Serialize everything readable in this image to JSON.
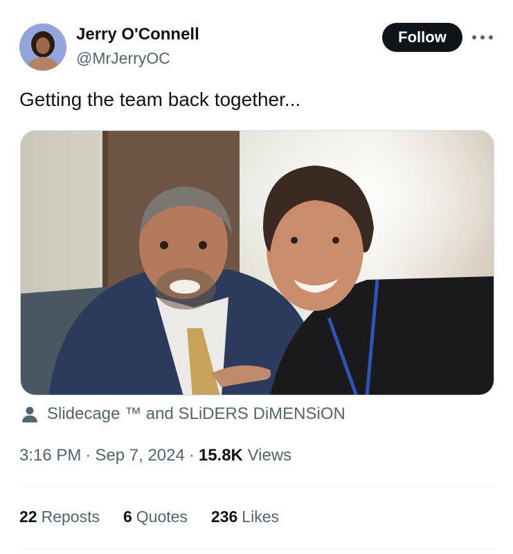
{
  "author": {
    "display_name": "Jerry O'Connell",
    "handle": "@MrJerryOC",
    "avatar_icon": "profile-photo"
  },
  "header": {
    "follow_label": "Follow",
    "more_icon": "more-dots-icon"
  },
  "tweet": {
    "text": "Getting the team back together..."
  },
  "media": {
    "kind": "photo"
  },
  "tags": {
    "icon": "person-icon",
    "text": "Slidecage ™ and SLiDERS DiMENSiON"
  },
  "meta": {
    "time": "3:16 PM",
    "separator": "·",
    "date": "Sep 7, 2024",
    "views_count": "15.8K",
    "views_label": "Views"
  },
  "stats": {
    "reposts_count": "22",
    "reposts_label": "Reposts",
    "quotes_count": "6",
    "quotes_label": "Quotes",
    "likes_count": "236",
    "likes_label": "Likes"
  },
  "colors": {
    "text_primary": "#0f1419",
    "text_secondary": "#536471",
    "follow_bg": "#0f1419",
    "divider": "#eff3f4"
  }
}
